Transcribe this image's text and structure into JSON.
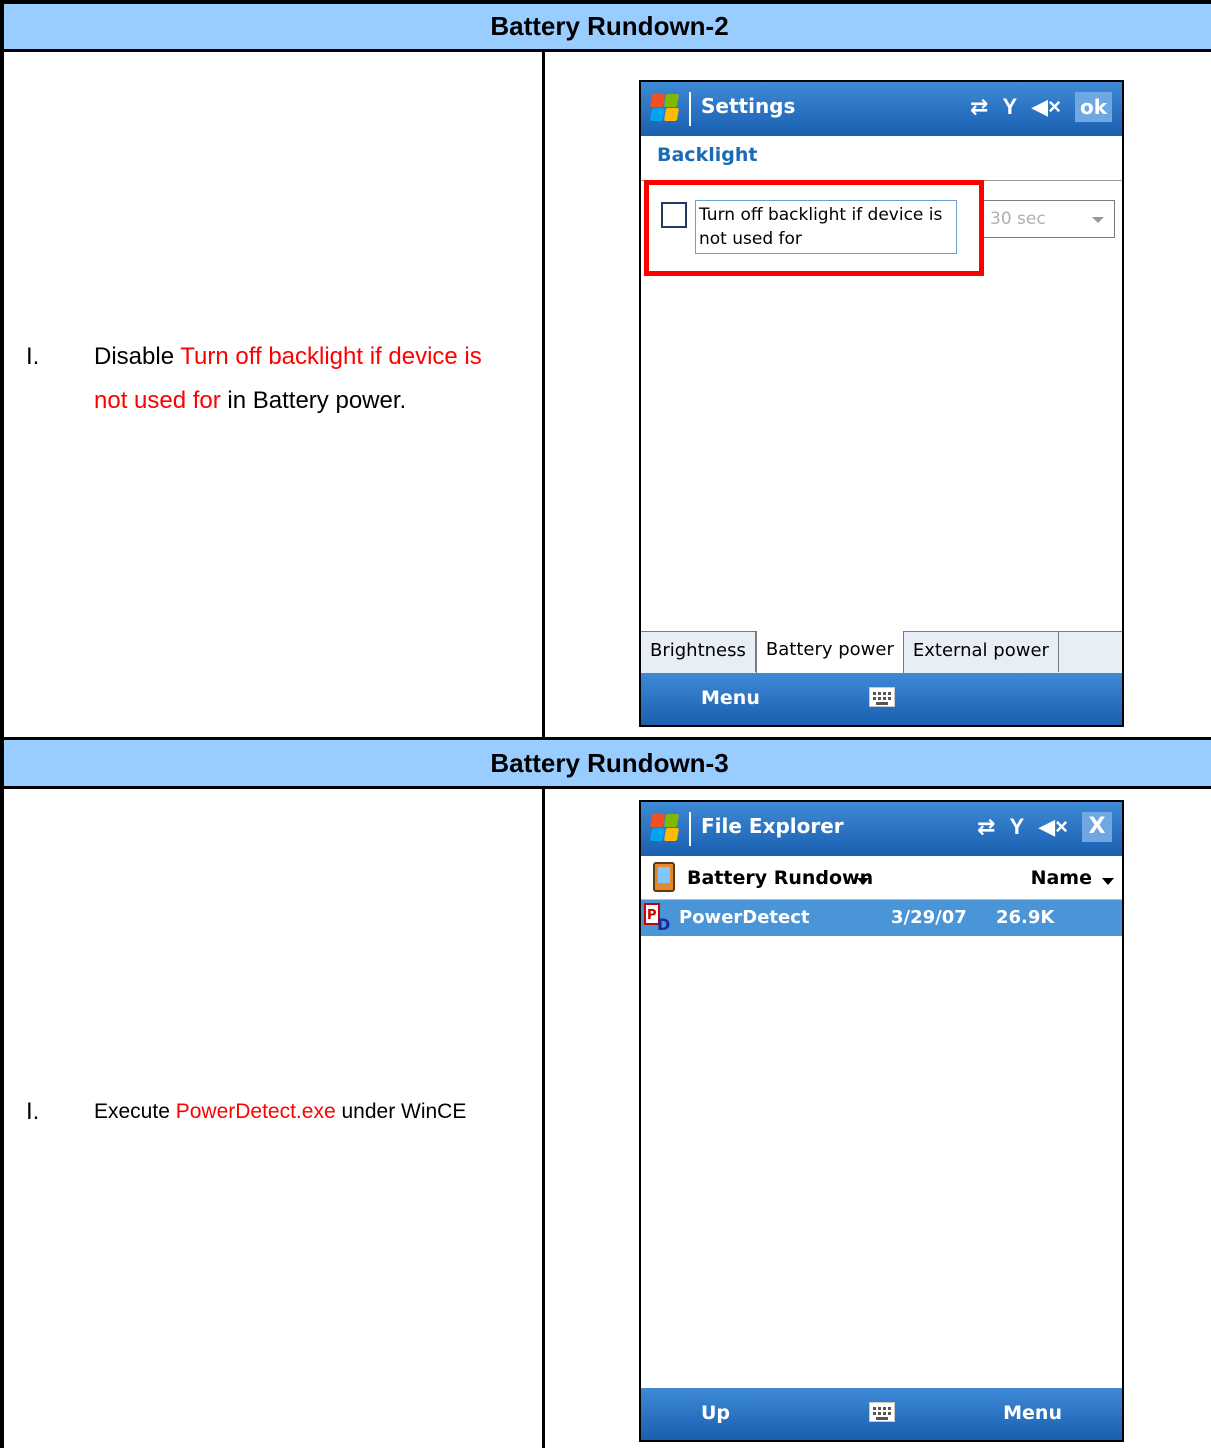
{
  "section1": {
    "header": "Battery Rundown-2",
    "step_number": "I.",
    "step_pre": "Disable ",
    "step_highlight": "Turn off backlight if device is not used for",
    "step_post": " in Battery power.",
    "screen": {
      "title": "Settings",
      "ok_label": "ok",
      "subheading": "Backlight",
      "checkbox_label": "Turn off backlight if device is not used for",
      "checkbox_checked": false,
      "dropdown_value": "30 sec",
      "tabs": [
        "Brightness",
        "Battery power",
        "External power"
      ],
      "active_tab": "Battery power",
      "softkey_left": "Menu"
    }
  },
  "section2": {
    "header": "Battery Rundown-3",
    "step_number": "I.",
    "step_pre": "Execute ",
    "step_highlight": "PowerDetect.exe",
    "step_post": " under WinCE",
    "screen": {
      "title": "File Explorer",
      "close_label": "X",
      "folder": "Battery Rundown",
      "sort": "Name",
      "file": {
        "name": "PowerDetect",
        "date": "3/29/07",
        "size": "26.9K"
      },
      "softkey_left": "Up",
      "softkey_right": "Menu"
    }
  },
  "colors": {
    "header_bg": "#99ccff",
    "highlight_text": "#ff0000",
    "titlebar_blue": "#1a5fb0",
    "selection_blue": "#4a94d8"
  }
}
